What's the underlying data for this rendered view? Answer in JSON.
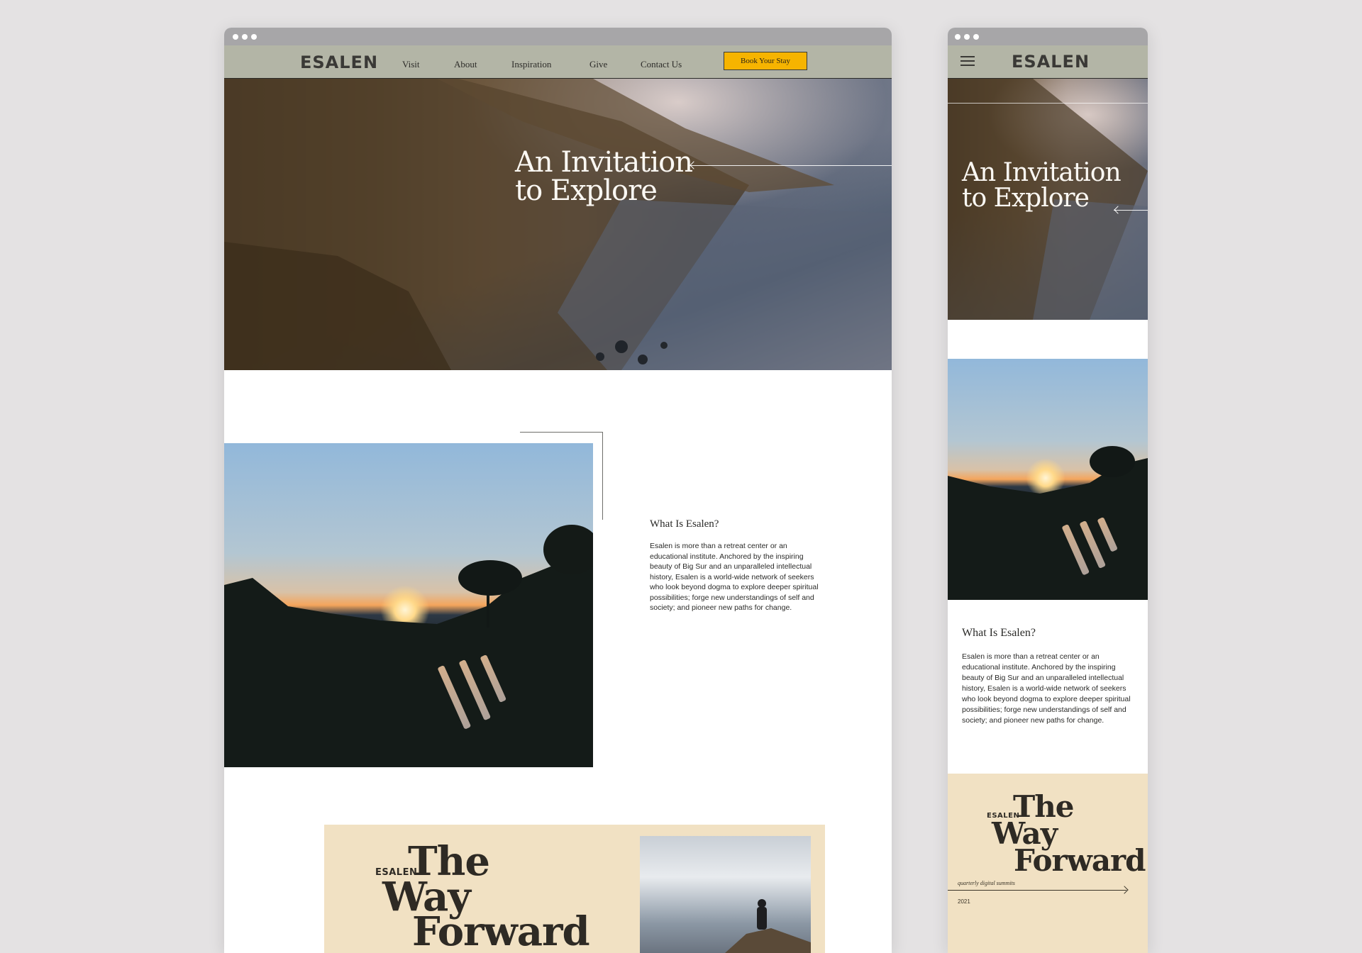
{
  "brand": "ESALEN",
  "nav": {
    "items": [
      "Visit",
      "About",
      "Inspiration",
      "Give",
      "Contact Us"
    ],
    "cta_label": "Book Your Stay"
  },
  "hero": {
    "line1": "An Invitation",
    "line2": "to Explore"
  },
  "about": {
    "heading": "What Is Esalen?",
    "body": "Esalen is more than a retreat center or an educational institute. Anchored by the inspiring beauty of Big Sur and an unparalleled intellectual history, Esalen is a world-wide network of seekers who look beyond dogma to explore deeper spiritual possibilities; forge new understandings of self and society; and pioneer new paths for change."
  },
  "way_forward": {
    "brand": "ESALEN",
    "line1": "The",
    "line2": "Way",
    "line3": "Forward",
    "subtitle": "quarterly digital summits",
    "year": "2021"
  },
  "colors": {
    "page_bg": "#e4e2e3",
    "nav_bg": "#b3b5a6",
    "cta": "#f6b400",
    "panel": "#f1e1c3"
  },
  "icons": [
    "menu-icon",
    "arrow-left-icon",
    "arrow-right-icon"
  ]
}
